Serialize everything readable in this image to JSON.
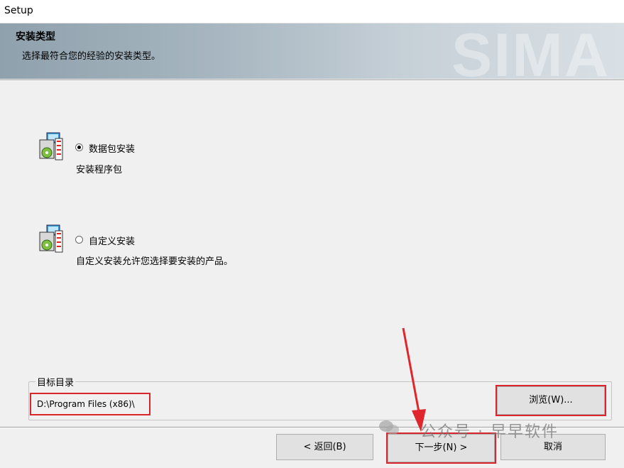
{
  "window": {
    "title": "Setup"
  },
  "banner": {
    "title": "安装类型",
    "subtitle": "选择最符合您的经验的安装类型。",
    "watermark": "SIMA"
  },
  "options": [
    {
      "label": "数据包安装",
      "description": "安装程序包",
      "selected": true,
      "icon": "package-install-icon"
    },
    {
      "label": "自定义安装",
      "description": "自定义安装允许您选择要安装的产品。",
      "selected": false,
      "icon": "custom-install-icon"
    }
  ],
  "target": {
    "legend": "目标目录",
    "path": "D:\\Program Files (x86)\\",
    "browse_label": "浏览(W)..."
  },
  "buttons": {
    "back": "< 返回(B)",
    "next": "下一步(N) >",
    "cancel": "取消"
  },
  "overlay": {
    "watermark_text": "公众号 · 早早软件",
    "highlight_color": "#d9262c"
  }
}
